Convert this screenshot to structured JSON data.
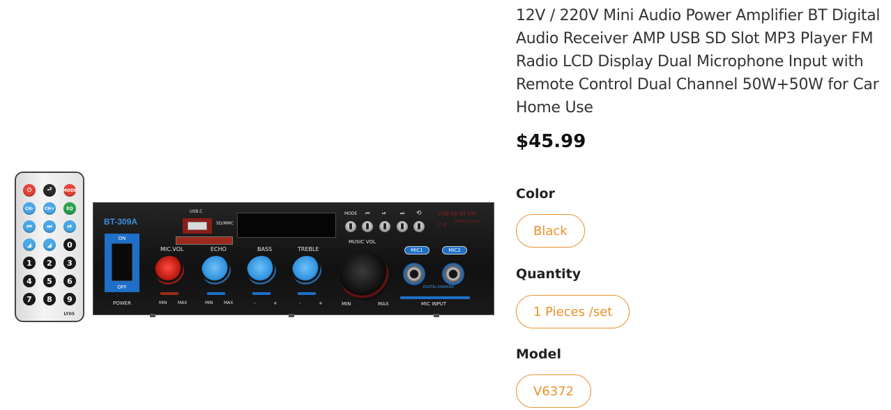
{
  "product": {
    "title": "12V / 220V Mini Audio Power Amplifier BT Digital Audio Receiver AMP USB SD Slot MP3 Player FM Radio LCD Display Dual Microphone Input with Remote Control Dual Channel 50W+50W for Car Home Use",
    "price": "$45.99"
  },
  "options": {
    "color": {
      "label": "Color",
      "selected": "Black"
    },
    "quantity": {
      "label": "Quantity",
      "selected": "1 Pieces /set"
    },
    "model": {
      "label": "Model",
      "selected": "V6372"
    }
  },
  "image": {
    "remote": {
      "model": "LY05",
      "rows": [
        [
          "⏻",
          "⮐",
          "MODE"
        ],
        [
          "CH-",
          "CH+",
          "EQ"
        ],
        [
          "⏮",
          "⏭",
          "⏯"
        ],
        [
          "◢",
          "◢",
          "0"
        ],
        [
          "1",
          "2",
          "3"
        ],
        [
          "4",
          "5",
          "6"
        ],
        [
          "7",
          "8",
          "9"
        ]
      ]
    },
    "amp": {
      "model": "BT-309A",
      "power_on": "ON",
      "power_off": "OFF",
      "power_label": "POWER",
      "usb_label": "USB.C",
      "sd_label": "SD/MMC",
      "mode_labels": [
        "MODE",
        "⏮",
        "⏯",
        "⏭",
        "⟲"
      ],
      "red_text_1": "USB SD BT FM",
      "red_text_2": "C-3",
      "red_text_3": "DIGITAL PLAY",
      "knob_labels": [
        "MIC.VOL",
        "ECHO",
        "BASS",
        "TREBLE",
        "MUSIC VOL"
      ],
      "min": "MIN",
      "max": "MAX",
      "minus": "-",
      "plus": "+",
      "mic1": "MIC1",
      "mic2": "MIC2",
      "digital_karaoke": "DIGITAL KARAOKE",
      "mic_input": "MIC INPUT"
    }
  }
}
